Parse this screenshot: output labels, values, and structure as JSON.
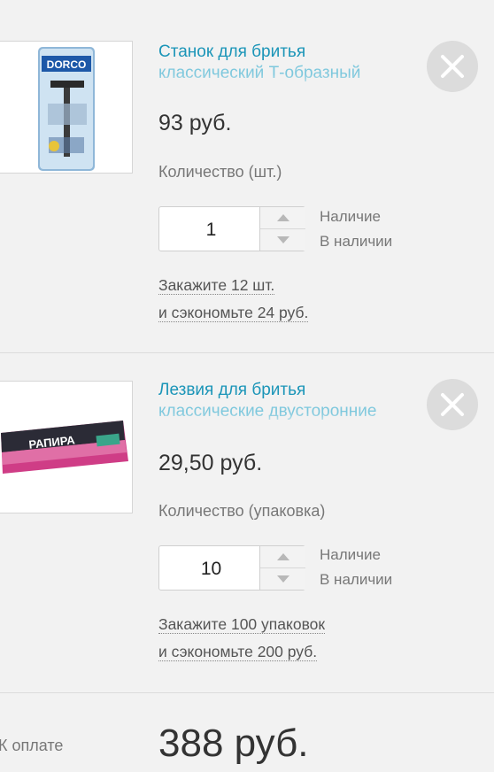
{
  "cart": {
    "items": [
      {
        "title_line1": "Станок для бритья",
        "title_line2": "классический Т-образный",
        "price": "93 руб.",
        "quantity_label": "Количество (шт.)",
        "quantity": "1",
        "availability_label": "Наличие",
        "availability_value": "В наличии",
        "promo_line1": "Закажите 12 шт.",
        "promo_line2": "и сэкономьте 24 руб.",
        "image_brand": "DORCO"
      },
      {
        "title_line1": "Лезвия для бритья",
        "title_line2": "классические двусторонние",
        "price": "29,50 руб.",
        "quantity_label": "Количество (упаковка)",
        "quantity": "10",
        "availability_label": "Наличие",
        "availability_value": "В наличии",
        "promo_line1": "Закажите 100 упаковок",
        "promo_line2": "и сэкономьте 200 руб.",
        "image_brand": "РАПИРА"
      }
    ],
    "total_label": "К оплате",
    "total_value": "388 руб."
  },
  "colors": {
    "link": "#1b95b8",
    "background": "#f2f2f2",
    "remove_button": "#dcdcdc"
  },
  "icons": {
    "remove": "close-icon",
    "increment": "chevron-up-icon",
    "decrement": "chevron-down-icon"
  }
}
